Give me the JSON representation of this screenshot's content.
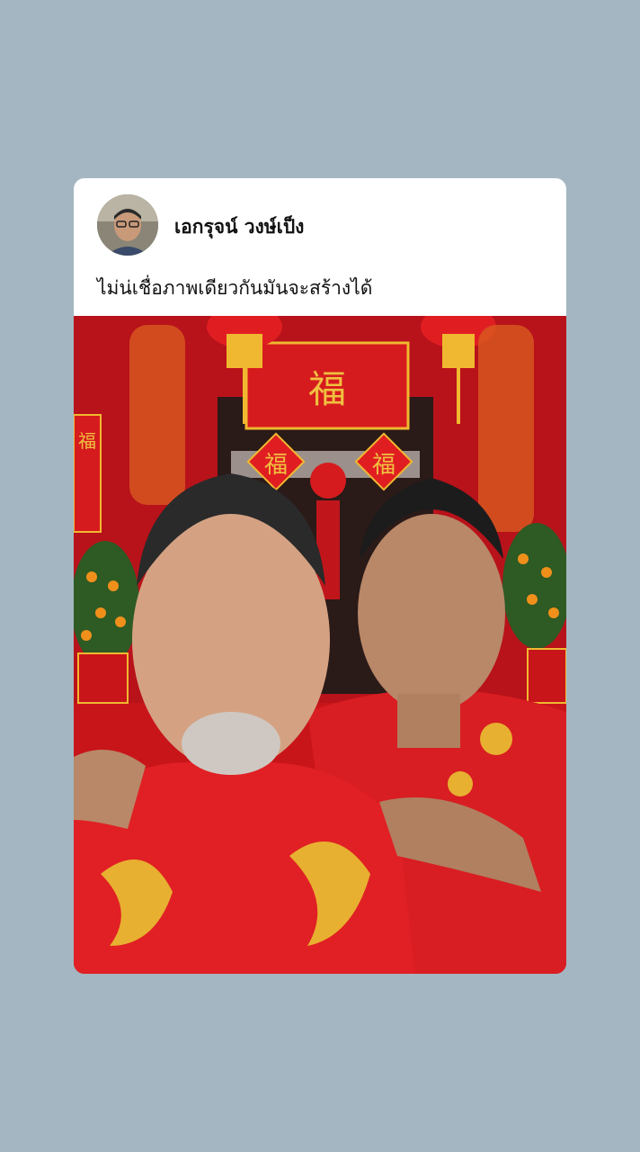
{
  "post": {
    "author_name": "เอกรุจน์ วงษ์เป็ง",
    "caption": "ไม่น่เชื่อภาพเดียวกันมันจะสร้างได้",
    "avatar_icon": "user-avatar",
    "photo": {
      "description_icon": "photo",
      "sign_characters": [
        "福",
        "福",
        "福",
        "福"
      ]
    }
  },
  "colors": {
    "background": "#a4b6c1",
    "card": "#ffffff",
    "red": "#d01818",
    "gold": "#f0b830"
  }
}
